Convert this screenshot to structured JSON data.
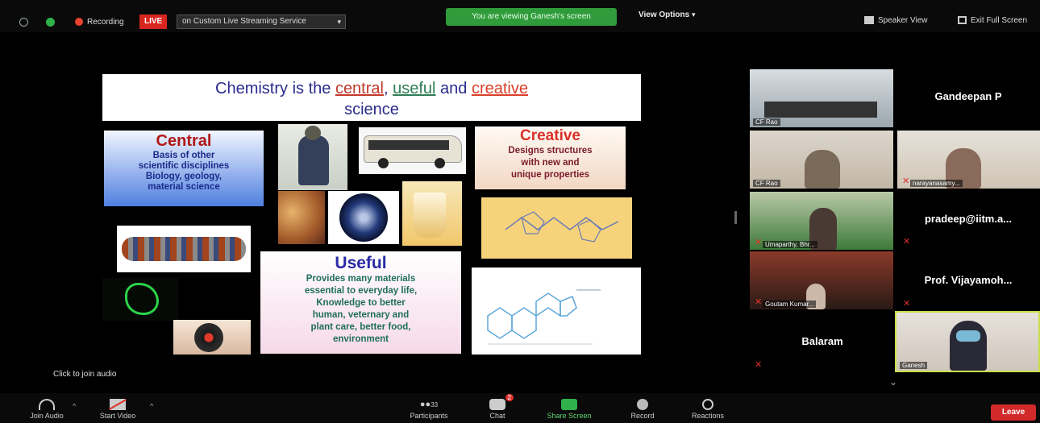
{
  "topbar": {
    "recording_label": "Recording",
    "live_label": "LIVE",
    "stream_service": "on Custom Live Streaming Service",
    "viewing_banner": "You are viewing Ganesh's screen",
    "view_options": "View Options",
    "speaker_view": "Speaker View",
    "exit_full_screen": "Exit Full Screen"
  },
  "slide": {
    "title_pre": "Chemistry is the ",
    "title_central": "central",
    "title_sep": ", ",
    "title_useful": "useful",
    "title_and": " and ",
    "title_creative": "creative",
    "title_line2": "science",
    "central": {
      "heading": "Central",
      "body_lines": [
        "Basis of other",
        "scientific disciplines",
        "Biology, geology,",
        "material science"
      ]
    },
    "creative": {
      "heading": "Creative",
      "body_lines": [
        "Designs structures",
        "with new and",
        "unique properties"
      ]
    },
    "useful": {
      "heading": "Useful",
      "body_lines": [
        "Provides many materials",
        "essential to everyday life,",
        "Knowledge to better",
        "human, veternary and",
        "plant care, better food,",
        "environment"
      ]
    }
  },
  "click_to_join_audio": "Click to join audio",
  "participants": {
    "tiles": [
      {
        "label": "CF Rao"
      },
      {
        "label": "CF Rao"
      },
      {
        "label": "narayanasamy..."
      },
      {
        "label": "Umaparthy, Bhr..."
      },
      {
        "label": "Goutam Kumar..."
      },
      {
        "label": "Ganesh"
      }
    ],
    "names": [
      "Gandeepan P",
      "pradeep@iitm.a...",
      "Prof. Vijayamoh...",
      "Balaram"
    ]
  },
  "bottombar": {
    "join_audio": "Join Audio",
    "start_video": "Start Video",
    "participants": "Participants",
    "participants_count": "33",
    "chat": "Chat",
    "chat_badge": "2",
    "share_screen": "Share Screen",
    "record": "Record",
    "reactions": "Reactions",
    "leave": "Leave"
  },
  "colors": {
    "live_red": "#d7261f",
    "banner_green": "#2f9b3a",
    "leave_red": "#d22a2a",
    "active_speaker_border": "#c9e04a"
  }
}
